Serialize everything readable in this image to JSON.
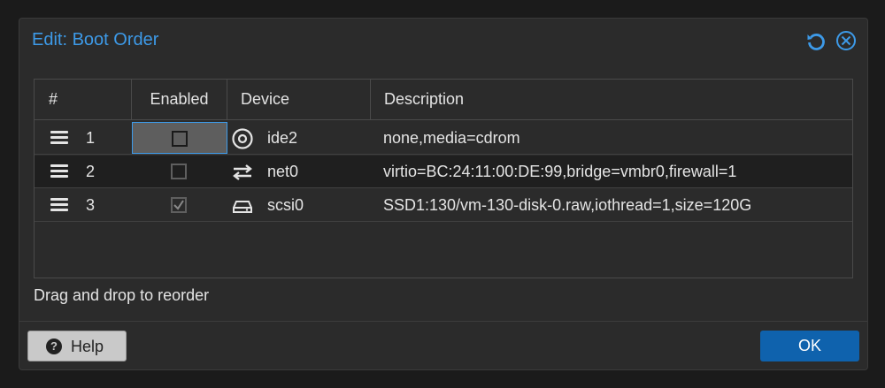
{
  "dialog": {
    "title": "Edit: Boot Order"
  },
  "grid": {
    "columns": [
      "#",
      "Enabled",
      "Device",
      "Description"
    ],
    "rows": [
      {
        "num": "1",
        "enabled": false,
        "device": "ide2",
        "device_icon": "cdrom-icon",
        "description": "none,media=cdrom"
      },
      {
        "num": "2",
        "enabled": false,
        "device": "net0",
        "device_icon": "network-arrows-icon",
        "description": "virtio=BC:24:11:00:DE:99,bridge=vmbr0,firewall=1"
      },
      {
        "num": "3",
        "enabled": true,
        "device": "scsi0",
        "device_icon": "hard-disk-icon",
        "description": "SSD1:130/vm-130-disk-0.raw,iothread=1,size=120G"
      }
    ]
  },
  "hint": "Drag and drop to reorder",
  "footer": {
    "help_label": "Help",
    "ok_label": "OK"
  },
  "colors": {
    "accent": "#3d9ae8",
    "ok_button": "#0f62ad",
    "background": "#2b2b2b"
  }
}
